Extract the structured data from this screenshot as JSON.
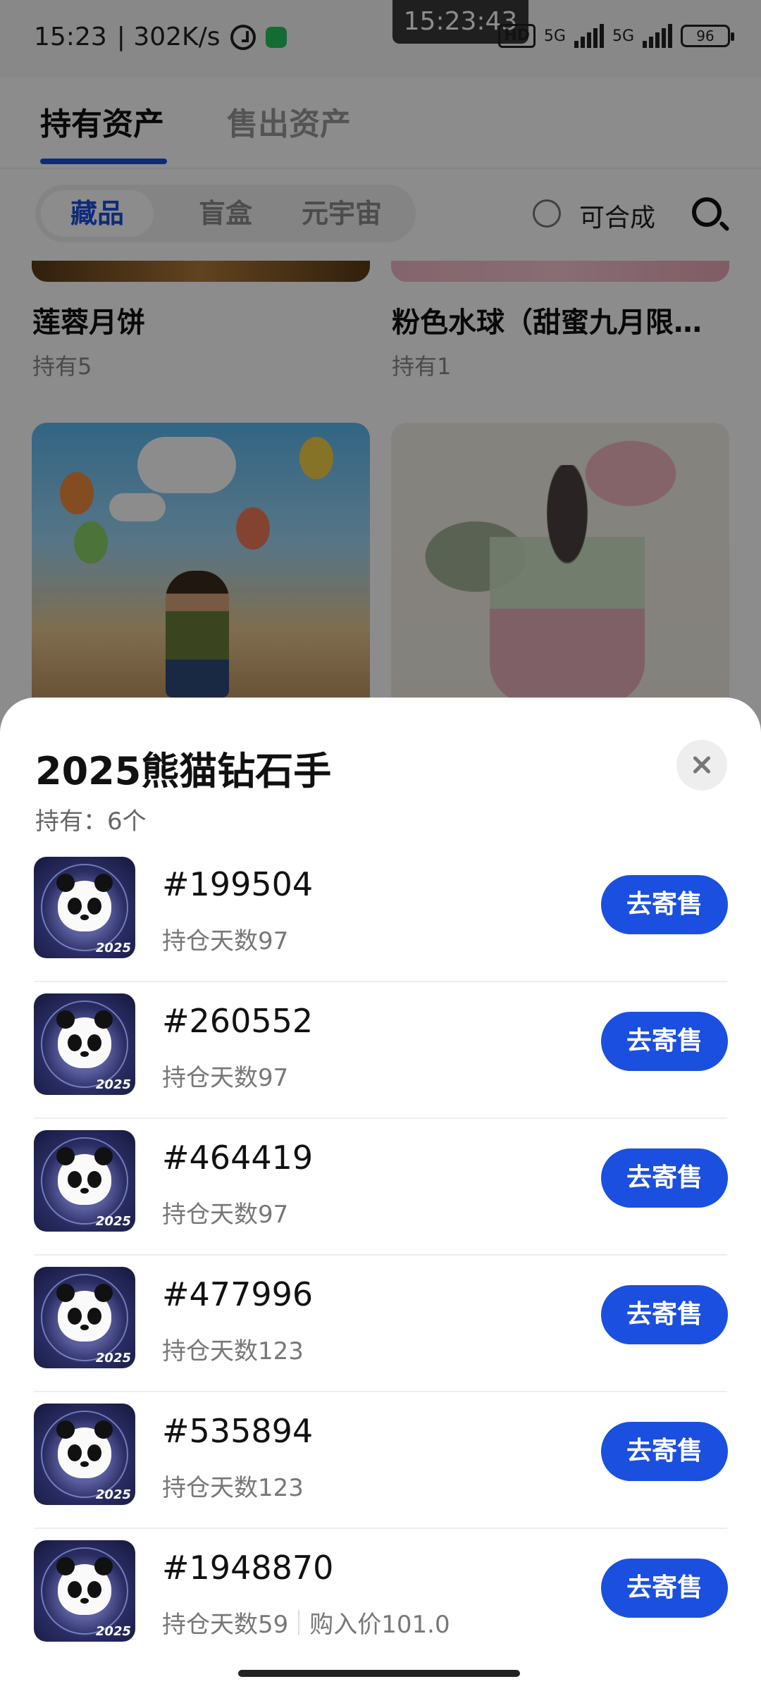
{
  "status_bar": {
    "time": "15:23",
    "net_speed": "| 302K/s",
    "clock_overlay": "15:23:43",
    "hd_badge": "HD",
    "net1": "5G",
    "net2": "5G",
    "battery": "96"
  },
  "top_tabs": {
    "held": "持有资产",
    "sold": "售出资产"
  },
  "filters": {
    "segments": [
      "藏品",
      "盲盒",
      "元宇宙"
    ],
    "composable_label": "可合成"
  },
  "background_cards": [
    {
      "title": "莲蓉月饼",
      "sub": "持有5"
    },
    {
      "title": "粉色水球（甜蜜九月限…",
      "sub": "持有1"
    }
  ],
  "sheet": {
    "title": "2025熊猫钻石手",
    "holding": "持有：6个",
    "thumb_year": "2025",
    "button_label": "去寄售",
    "items": [
      {
        "id": "#199504",
        "days": "持仓天数97"
      },
      {
        "id": "#260552",
        "days": "持仓天数97"
      },
      {
        "id": "#464419",
        "days": "持仓天数97"
      },
      {
        "id": "#477996",
        "days": "持仓天数123"
      },
      {
        "id": "#535894",
        "days": "持仓天数123"
      },
      {
        "id": "#1948870",
        "days": "持仓天数59",
        "price": "购入价101.0"
      }
    ]
  },
  "colors": {
    "accent": "#1a4fe0"
  },
  "icons": [
    "alarm-icon",
    "phone-call-icon",
    "signal-icon",
    "battery-icon",
    "search-icon",
    "close-icon"
  ]
}
